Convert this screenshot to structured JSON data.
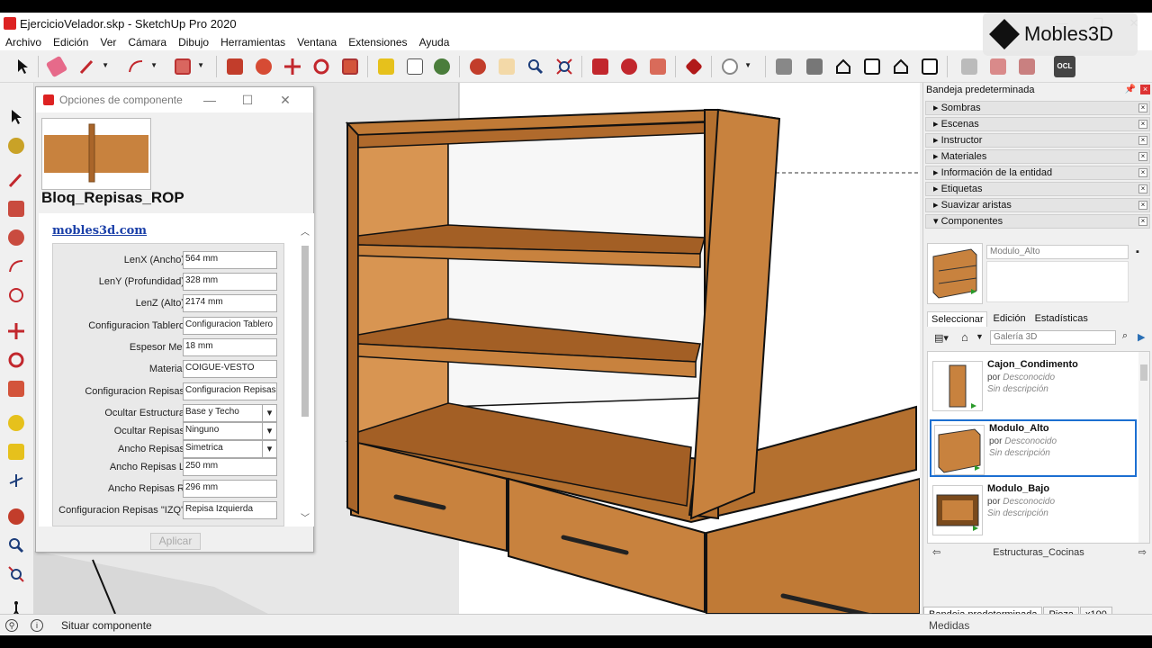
{
  "window": {
    "title": "EjercicioVelador.skp - SketchUp Pro 2020",
    "controls": [
      "—",
      "❐",
      "✕"
    ]
  },
  "menu": [
    "Archivo",
    "Edición",
    "Ver",
    "Cámara",
    "Dibujo",
    "Herramientas",
    "Ventana",
    "Extensiones",
    "Ayuda"
  ],
  "watermark": {
    "text": "Mobles3D"
  },
  "toolbar": {
    "ocl_label": "OCL"
  },
  "dialog": {
    "title": "Opciones de componente",
    "controls": [
      "—",
      "☐",
      "✕"
    ],
    "component_name": "Bloq_Repisas_ROP",
    "link": "mobles3d.com",
    "apply_label": "Aplicar",
    "params": [
      {
        "label": "LenX (Ancho)",
        "value": "564 mm",
        "type": "text"
      },
      {
        "label": "LenY (Profundidad)",
        "value": "328 mm",
        "type": "text"
      },
      {
        "label": "LenZ (Alto)",
        "value": "2174 mm",
        "type": "text"
      },
      {
        "label": "Configuracion Tablero",
        "value": "Configuracion Tablero",
        "type": "text"
      },
      {
        "label": "Espesor Mel",
        "value": "18 mm",
        "type": "text"
      },
      {
        "label": "Material",
        "value": "COIGUE-VESTO",
        "type": "text"
      },
      {
        "label": "Configuracion Repisas",
        "value": "Configuracion Repisas",
        "type": "text"
      },
      {
        "label": "Ocultar Estructura",
        "value": "Base y Techo",
        "type": "select"
      },
      {
        "label": "Ocultar Repisas",
        "value": "Ninguno",
        "type": "select"
      },
      {
        "label": "Ancho Repisas",
        "value": "Simetrica",
        "type": "select"
      },
      {
        "label": "Ancho Repisas L",
        "value": "250 mm",
        "type": "text"
      },
      {
        "label": "Ancho Repisas R",
        "value": "296 mm",
        "type": "text"
      },
      {
        "label": "Configuracion Repisas \"IZQ\"",
        "value": "Repisa Izquierda",
        "type": "text"
      }
    ]
  },
  "tray": {
    "title": "Bandeja predeterminada",
    "sections": [
      "Sombras",
      "Escenas",
      "Instructor",
      "Materiales",
      "Información de la entidad",
      "Etiquetas",
      "Suavizar aristas",
      "Componentes"
    ],
    "component_field": "Modulo_Alto",
    "tabs": [
      "Seleccionar",
      "Edición",
      "Estadísticas"
    ],
    "search_placeholder": "Galería 3D",
    "items": [
      {
        "name": "Cajon_Condimento",
        "by": "por",
        "author": "Desconocido",
        "desc": "Sin descripción"
      },
      {
        "name": "Modulo_Alto",
        "by": "por",
        "author": "Desconocido",
        "desc": "Sin descripción"
      },
      {
        "name": "Modulo_Bajo",
        "by": "por",
        "author": "Desconocido",
        "desc": "Sin descripción"
      }
    ],
    "collection": "Estructuras_Cocinas",
    "bottom_tabs": [
      "Bandeja predeterminada",
      "Pieza",
      "x100"
    ]
  },
  "status": {
    "text": "Situar componente",
    "measure_label": "Medidas"
  },
  "colors": {
    "wood": "#c8823e",
    "wood_dark": "#a9652a",
    "select_blue": "#1c6fd1"
  }
}
